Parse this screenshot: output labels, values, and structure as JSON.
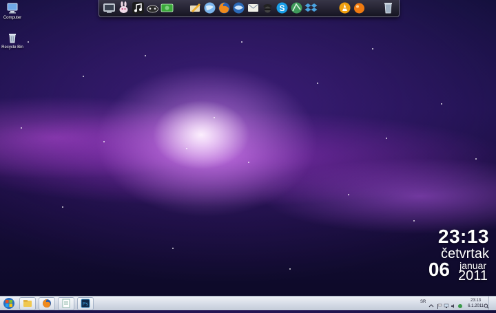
{
  "desktop": {
    "icons": [
      {
        "label": "Computer"
      },
      {
        "label": "Recycle Bin"
      }
    ]
  },
  "dock": {
    "items": [
      "terminal-icon",
      "rabbit-icon",
      "music-icon",
      "gamepad-icon",
      "money-icon",
      "pencil-icon",
      "globe-icon",
      "firefox-icon",
      "thunderbird-icon",
      "mail-icon",
      "spy-icon",
      "skype-icon",
      "network-icon",
      "dropbox-icon",
      "vlc-icon",
      "orange-icon",
      "trash-icon"
    ]
  },
  "clock": {
    "time": "23:13",
    "weekday": "četvrtak",
    "day": "06",
    "month": "januar",
    "year": "2011"
  },
  "taskbar": {
    "pinned": [
      "explorer-icon",
      "firefox-icon",
      "notepad-icon",
      "photoshop-icon"
    ],
    "tray": {
      "language": "SR",
      "time": "23:13",
      "date": "6.1.2011"
    }
  },
  "colors": {
    "taskbar": "#d5dbe6",
    "nebula": "#c86ef0",
    "sky": "#170c3c"
  }
}
